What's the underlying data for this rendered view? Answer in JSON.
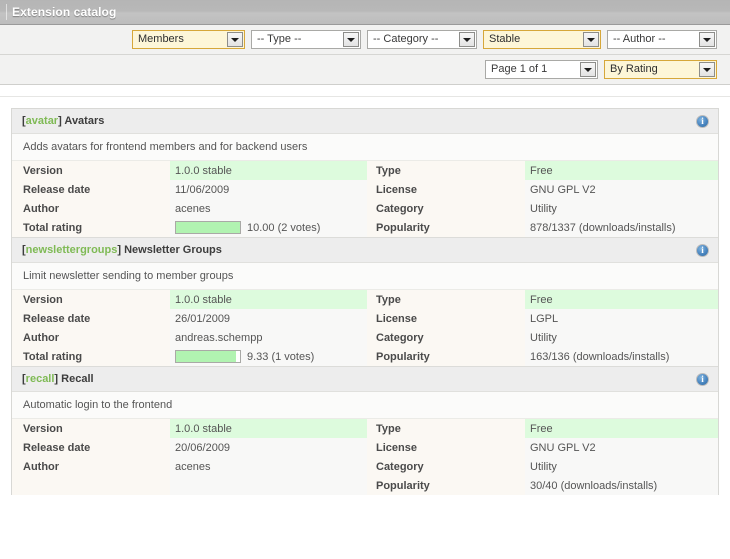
{
  "window": {
    "title": "Extension catalog"
  },
  "filters": {
    "row1": [
      {
        "name": "filter-scope",
        "value": "Members",
        "active": true,
        "width_class": "w-members"
      },
      {
        "name": "filter-type",
        "value": "-- Type --",
        "active": false,
        "width_class": "w-type"
      },
      {
        "name": "filter-category",
        "value": "-- Category --",
        "active": false,
        "width_class": "w-category"
      },
      {
        "name": "filter-state",
        "value": "Stable",
        "active": true,
        "width_class": "w-stable"
      },
      {
        "name": "filter-author",
        "value": "-- Author --",
        "active": false,
        "width_class": "w-author"
      }
    ],
    "row2": [
      {
        "name": "pagination-select",
        "value": "Page 1 of 1",
        "active": false,
        "width_class": "w-page"
      },
      {
        "name": "sort-select",
        "value": "By Rating",
        "active": true,
        "width_class": "w-sort"
      }
    ]
  },
  "labels": {
    "version": "Version",
    "release_date": "Release date",
    "author": "Author",
    "total_rating": "Total rating",
    "type": "Type",
    "license": "License",
    "category": "Category",
    "popularity": "Popularity",
    "info_glyph": "i"
  },
  "colors": {
    "accent_green": "#7fba55",
    "highlight_row": "#ddfbdd",
    "rating_fill": "#b1f3b1",
    "active_select_bg": "#fdf6d8",
    "active_select_border": "#d6a73a",
    "titlebar": "#bdbdbd",
    "info_icon": "#4a86c0"
  },
  "extensions": [
    {
      "tag": "avatar",
      "title": "Avatars",
      "description": "Adds avatars for frontend members and for backend users",
      "version": "1.0.0 stable",
      "release_date": "11/06/2009",
      "author": "acenes",
      "rating_value": "10.00 (2 votes)",
      "rating_percent": 100,
      "type": "Free",
      "license": "GNU GPL V2",
      "category": "Utility",
      "popularity": "878/1337 (downloads/installs)",
      "has_rating": true
    },
    {
      "tag": "newslettergroups",
      "title": "Newsletter Groups",
      "description": "Limit newsletter sending to member groups",
      "version": "1.0.0 stable",
      "release_date": "26/01/2009",
      "author": "andreas.schempp",
      "rating_value": "9.33 (1 votes)",
      "rating_percent": 93,
      "type": "Free",
      "license": "LGPL",
      "category": "Utility",
      "popularity": "163/136 (downloads/installs)",
      "has_rating": true
    },
    {
      "tag": "recall",
      "title": "Recall",
      "description": "Automatic login to the frontend",
      "version": "1.0.0 stable",
      "release_date": "20/06/2009",
      "author": "acenes",
      "rating_value": "",
      "rating_percent": 0,
      "type": "Free",
      "license": "GNU GPL V2",
      "category": "Utility",
      "popularity": "30/40 (downloads/installs)",
      "has_rating": false
    }
  ]
}
